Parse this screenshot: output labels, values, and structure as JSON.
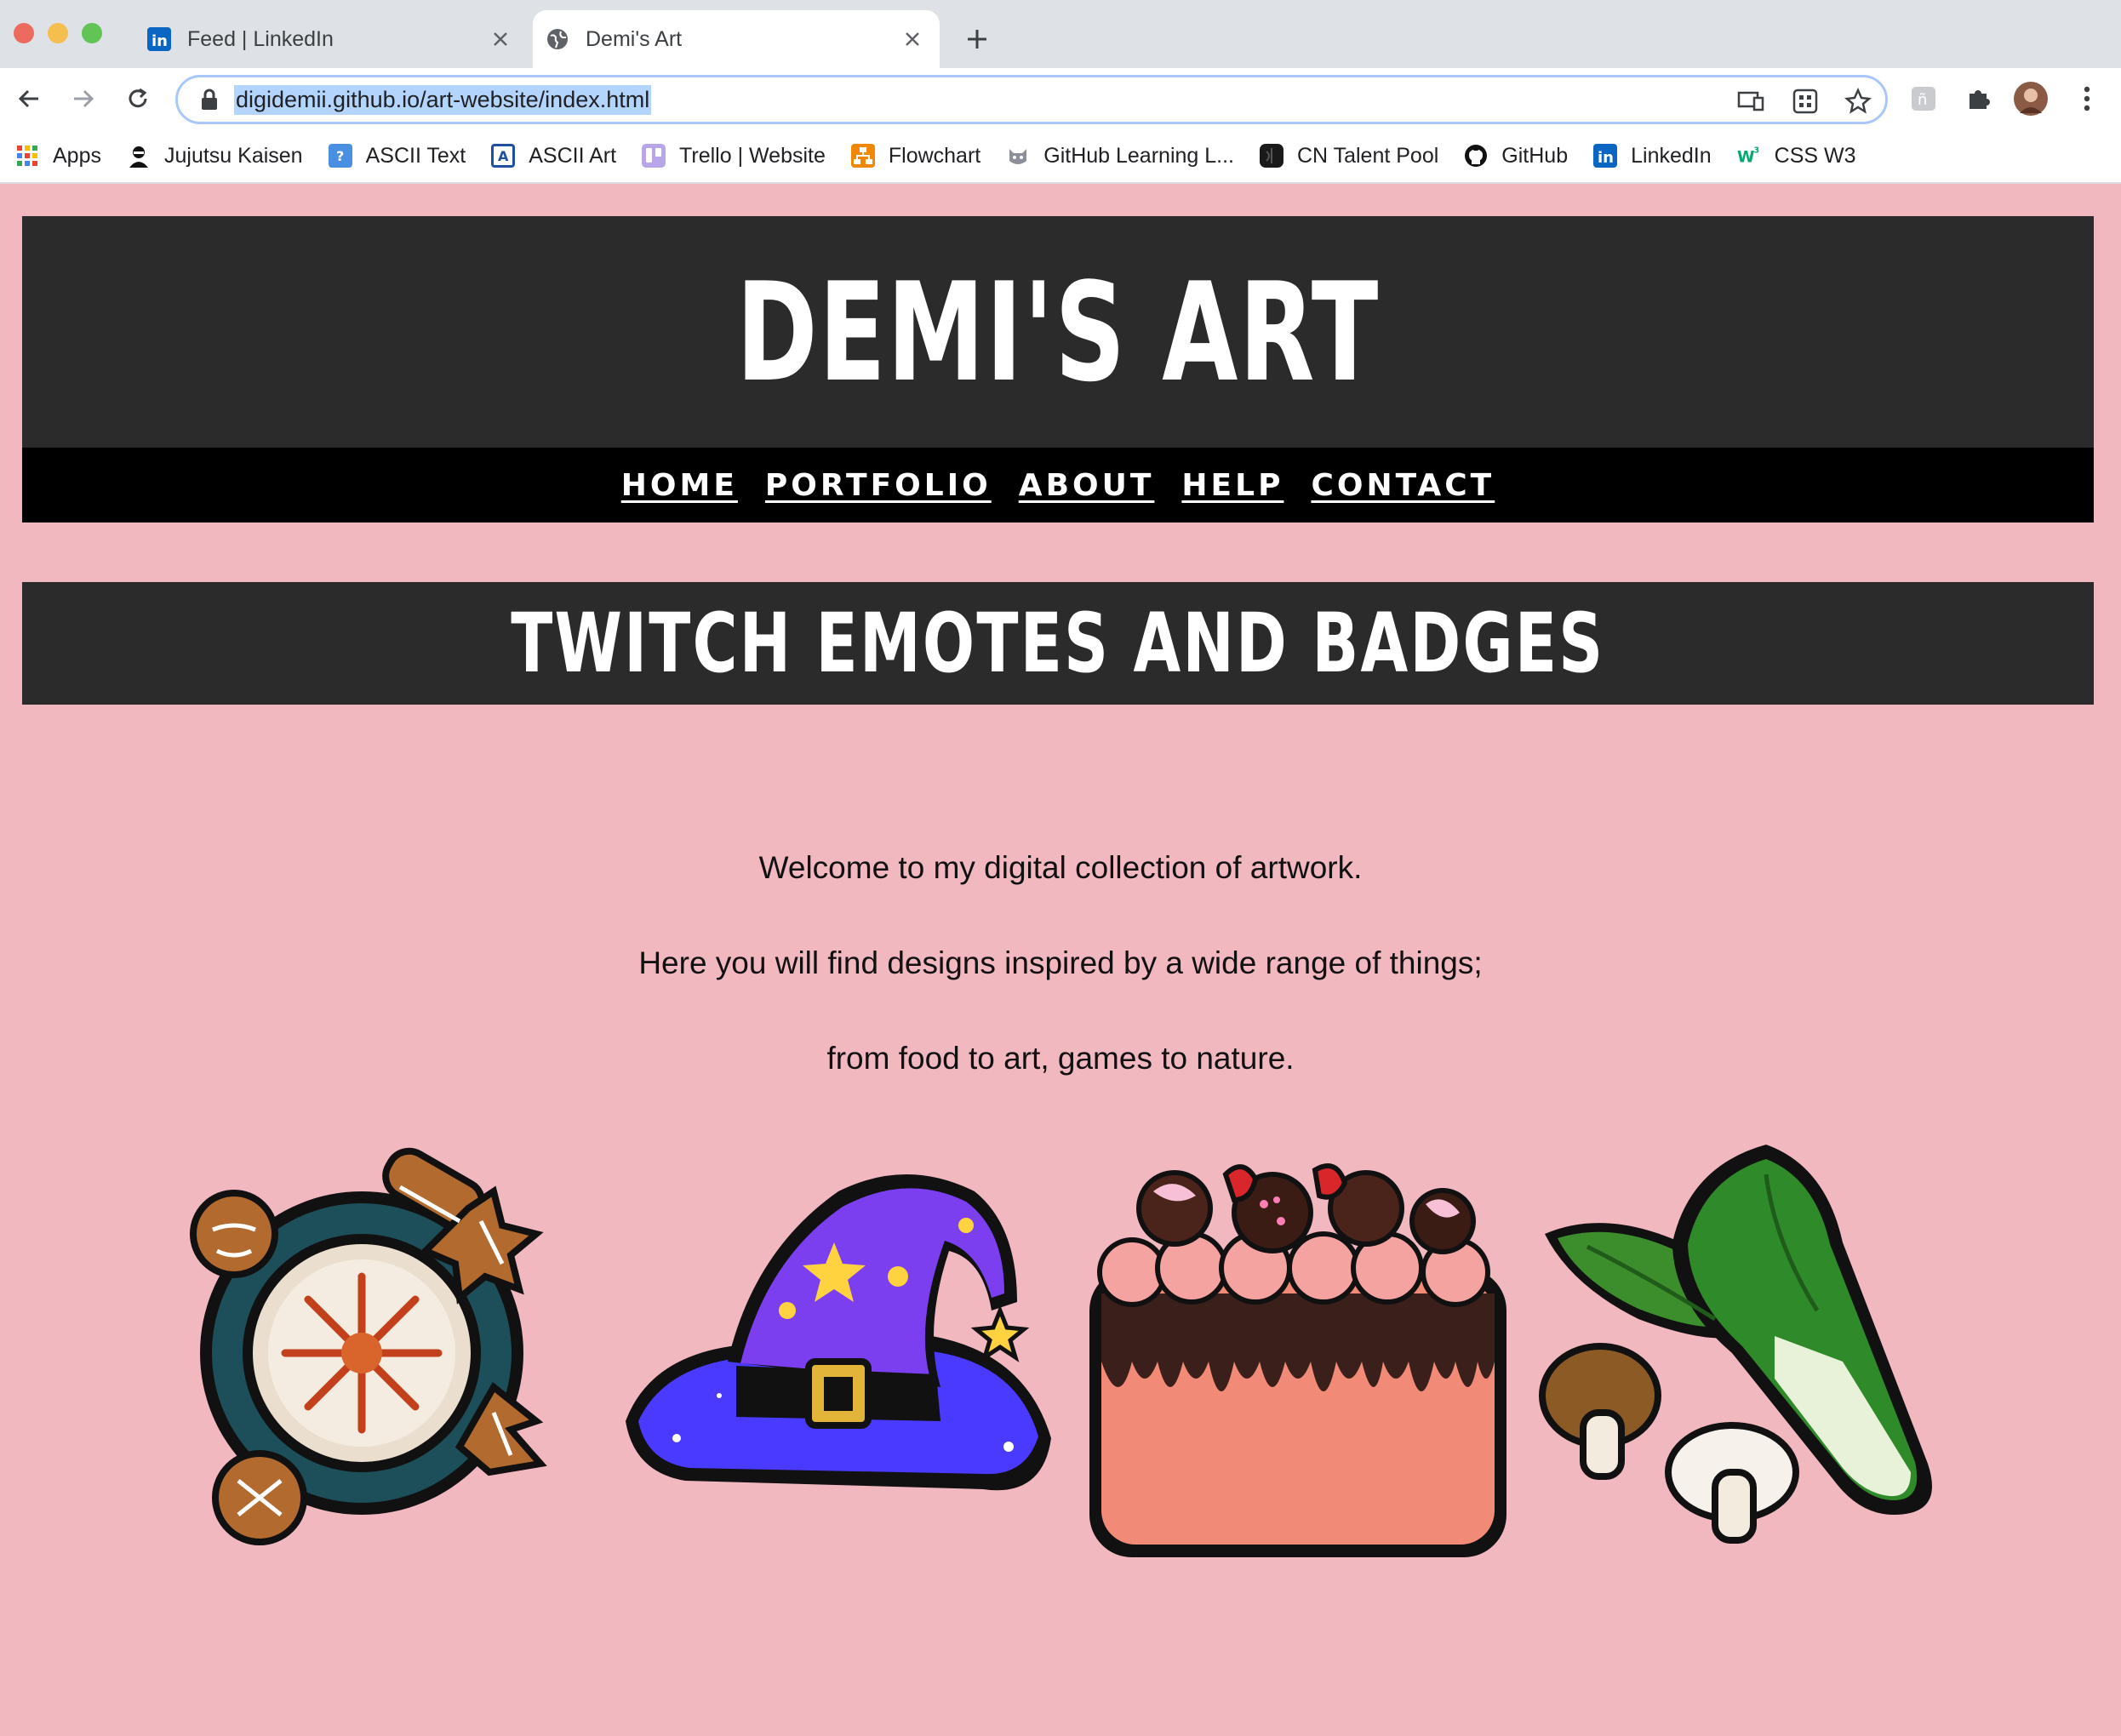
{
  "browser": {
    "tabs": [
      {
        "title": "Feed | LinkedIn",
        "active": false,
        "icon": "linkedin-icon"
      },
      {
        "title": "Demi's Art",
        "active": true,
        "icon": "globe-icon"
      }
    ],
    "url": "digidemii.github.io/art-website/index.html",
    "bookmarks": [
      {
        "label": "Apps",
        "icon": "apps-grid-icon"
      },
      {
        "label": "Jujutsu Kaisen",
        "icon": "anime-avatar-icon"
      },
      {
        "label": "ASCII Text",
        "icon": "ascii-text-icon"
      },
      {
        "label": "ASCII Art",
        "icon": "ascii-art-icon"
      },
      {
        "label": "Trello | Website",
        "icon": "trello-icon"
      },
      {
        "label": "Flowchart",
        "icon": "flowchart-icon"
      },
      {
        "label": "GitHub Learning L...",
        "icon": "cat-icon"
      },
      {
        "label": "CN Talent Pool",
        "icon": "talent-pool-icon"
      },
      {
        "label": "GitHub",
        "icon": "github-icon"
      },
      {
        "label": "LinkedIn",
        "icon": "linkedin-icon"
      },
      {
        "label": "CSS W3",
        "icon": "w3-icon"
      }
    ]
  },
  "page": {
    "site_title": "DEMI'S ART",
    "nav": [
      "HOME",
      "PORTFOLIO",
      "ABOUT",
      "HELP",
      "CONTACT"
    ],
    "section_title": "TWITCH EMOTES AND BADGES",
    "intro": [
      "Welcome to my digital collection of artwork.",
      "Here you will find designs inspired by a wide range of things;",
      "from food to art, games to nature."
    ],
    "artworks": [
      {
        "subject": "gingerbread cookies and latte"
      },
      {
        "subject": "purple wizard hat"
      },
      {
        "subject": "chocolate drip cake"
      },
      {
        "subject": "bok choy and mushrooms"
      }
    ]
  },
  "colors": {
    "page_background": "#f2b8c0",
    "header_background": "#2b2b2b",
    "nav_background": "#000000",
    "text_light": "#ffffff"
  }
}
